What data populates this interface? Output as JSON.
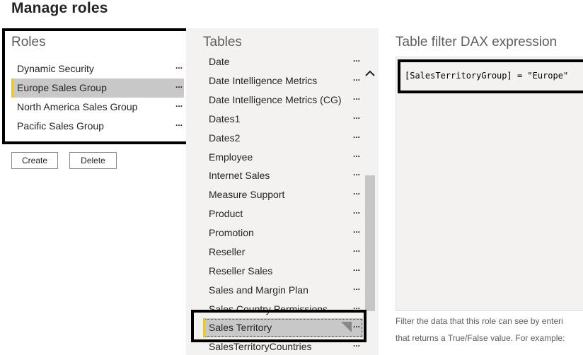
{
  "dialog": {
    "title": "Manage roles"
  },
  "roles": {
    "heading": "Roles",
    "items": [
      {
        "label": "Dynamic Security",
        "more": "..."
      },
      {
        "label": "Europe Sales Group",
        "more": "...",
        "selected": true
      },
      {
        "label": "North America Sales Group",
        "more": "..."
      },
      {
        "label": "Pacific Sales Group",
        "more": "..."
      }
    ],
    "create_label": "Create",
    "delete_label": "Delete"
  },
  "tables": {
    "heading": "Tables",
    "items": [
      {
        "label": "Date",
        "more": "..."
      },
      {
        "label": "Date Intelligence Metrics",
        "more": "..."
      },
      {
        "label": "Date Intelligence Metrics (CG)",
        "more": "..."
      },
      {
        "label": "Dates1",
        "more": "..."
      },
      {
        "label": "Dates2",
        "more": "..."
      },
      {
        "label": "Employee",
        "more": "..."
      },
      {
        "label": "Internet Sales",
        "more": "..."
      },
      {
        "label": "Measure Support",
        "more": "..."
      },
      {
        "label": "Product",
        "more": "..."
      },
      {
        "label": "Promotion",
        "more": "..."
      },
      {
        "label": "Reseller",
        "more": "..."
      },
      {
        "label": "Reseller Sales",
        "more": "..."
      },
      {
        "label": "Sales and Margin Plan",
        "more": "..."
      },
      {
        "label": "Sales Country Permissions",
        "more": "..."
      },
      {
        "label": "Sales Territory",
        "more": "...",
        "selected": true,
        "has_filter": true
      },
      {
        "label": "SalesTerritoryCountries",
        "more": "..."
      }
    ]
  },
  "dax": {
    "heading": "Table filter DAX expression",
    "expression": "[SalesTerritoryGroup] = \"Europe\"",
    "help_line1": "Filter the data that this role can see by enteri",
    "help_line2": "that returns a True/False value. For example: "
  },
  "colors": {
    "accent": "#f2c811",
    "selected_bg": "#c8c8c8",
    "panel_bg": "#f3f2f1",
    "callout": "#000000"
  },
  "icons": {
    "scroll_up": "chevron-up-icon",
    "filter": "filter-corner-icon",
    "more": "ellipsis-icon"
  }
}
